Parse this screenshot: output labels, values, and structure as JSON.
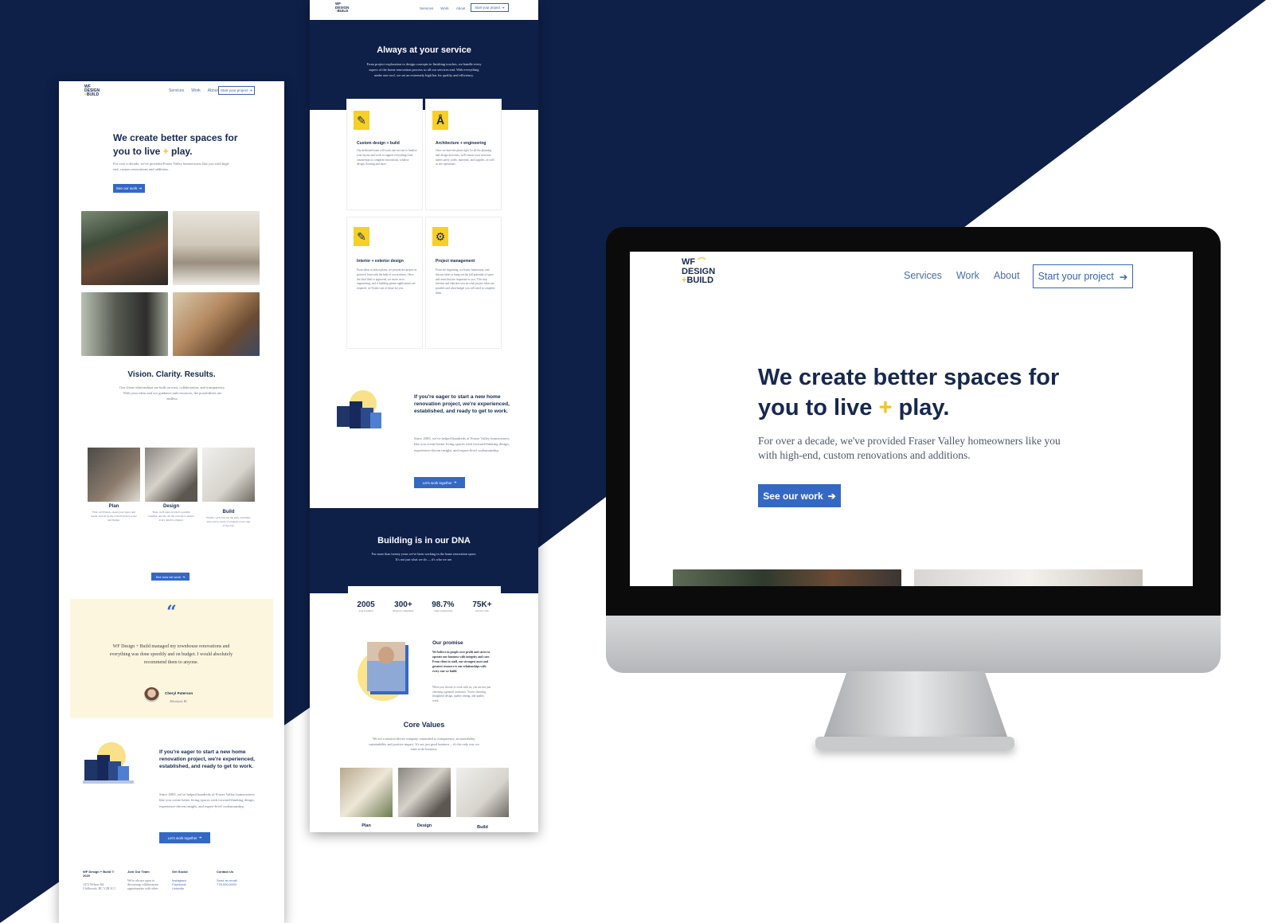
{
  "brand": {
    "logo_line1": "WF",
    "logo_line2": "DESIGN",
    "logo_plus": "+",
    "logo_line3": "BUILD",
    "accent": "#f4c21a",
    "navy": "#0e1f48",
    "blue": "#3468c4"
  },
  "nav": {
    "services": "Services",
    "work": "Work",
    "about": "About",
    "cta": "Start your project",
    "cta_icon": "arrow-right-icon"
  },
  "hero": {
    "title_line1": "We create better spaces for",
    "title_pre": "you to live ",
    "title_plus": "+",
    "title_post": " play.",
    "body_line1": "For over a decade, we've provided Fraser Valley homeowners like you",
    "body_line2": "with high-end, custom renovations and additions.",
    "cta": "See our work"
  },
  "home_page": {
    "vision_title": "Vision. Clarity. Results.",
    "vision_body": "Our client relationships are built on trust, collaboration, and transparency. With your ideas and our guidance and resources, the possibilities are endless.",
    "steps": [
      {
        "label": "Plan",
        "body": "First, we'll listen, assess your space and needs, and set up the overall project scope and budget."
      },
      {
        "label": "Design",
        "body": "Then, we'll explore what's possible together, and lay out the concept to ensure every detail is aligned."
      },
      {
        "label": "Build",
        "body": "Finally, we'll execute the plan, and make sure you're aware of progress every step of the way."
      }
    ],
    "steps_cta": "See how we work",
    "quote_icon": "quote-icon",
    "quote": "WF Design + Build managed my townhouse renovations and everything was done speedily and on budget. I would absolutely recommend them to anyone.",
    "author": "Cheryl Paterson",
    "author_location": "Abbotsford, BC",
    "eager_title": "If you're eager to start a new home renovation project, we're experienced, established, and ready to get to work.",
    "eager_body": "Since 2005, we've helped hundreds of Fraser Valley homeowners like you create better living spaces with forward-thinking design, experience-driven insight, and expert-level craftsmanship.",
    "eager_cta": "Let's work together",
    "footer": {
      "col1_title": "WF Design + Build © 2020",
      "col1_lines": [
        "1472 Wilson Rd.",
        "Chilliwack, BC V2R 5C1"
      ],
      "col2_title": "Join Our Team",
      "col2_lines": [
        "We're always open to",
        "discussing collaboration",
        "opportunities with other"
      ],
      "col3_title": "Get Social",
      "col3_lines": [
        "Instagram",
        "Facebook",
        "LinkedIn"
      ],
      "col4_title": "Contact Us",
      "col4_lines": [
        "Send an email",
        "778-000-0000"
      ]
    }
  },
  "services_page": {
    "title": "Always at your service",
    "intro": "From project exploration to design concepts to finishing touches, we handle every aspect of the home renovation process so all our services end. With everything under one roof, we set an extremely high bar for quality and efficiency.",
    "services": [
      {
        "title": "Custom design + build",
        "icon": "pencil-ruler-icon",
        "body": "Our dedicated team will work one-on-one to finalize your layout and work to support everything from countertops to complete renovations, window design, flooring and more."
      },
      {
        "title": "Architecture + engineering",
        "icon": "compass-icon",
        "body": "Once we have the plans right for all the planning and design decisions, we'll ensure your structure meets safety codes, materials, and supplies, as well as site operations."
      },
      {
        "title": "Interior + exterior design",
        "icon": "pencil-ruler-icon",
        "body": "From ideas to drawn plans, we present the project in pictured form with the help of our architect. Once the final draft is approved, we move on to engineering, and if building permit applications are required, we'll take care of those for you."
      },
      {
        "title": "Project management",
        "icon": "gears-icon",
        "body": "From the beginning, we listen, brainstorm, and discuss ideas to hang out the full potential of space and areas that are important to you. This step informs and educates you on what project ideas are possible and what budget you will need to complete them."
      }
    ],
    "eager_title": "If you're eager to start a new home renovation project, we're experienced, established, and ready to get to work.",
    "eager_body": "Since 2005, we've helped hundreds of Fraser Valley homeowners like you create better living spaces with forward-thinking design, experience-driven insight, and expert-level craftsmanship.",
    "eager_cta": "Let's work together"
  },
  "about_page": {
    "dna_title": "Building is in our DNA",
    "dna_body": "For more than twenty years we've been working in the home renovation space. It's not just what we do — it's who we are.",
    "stats": [
      {
        "value": "2005",
        "label": "year founded"
      },
      {
        "value": "300+",
        "label": "Projects completed"
      },
      {
        "value": "98.7%",
        "label": "client satisfaction"
      },
      {
        "value": "75K+",
        "label": "service calls"
      }
    ],
    "promise_title": "Our promise",
    "promise_body": "We believe in people over profit and strive to operate our business with integrity and care. From client to staff, our strongest asset and greatest resource is our relationships with every one we build.",
    "promise_body2": "When you choose to work with us, you are not just choosing a general contractor. You're choosing thoughtful design, quality timing, and quality work.",
    "values_title": "Core Values",
    "values_body": "We are a mission-driven company committed to transparency, accountability, sustainability and positive impact. It's not just good business – it's the only way we want to do business.",
    "values": [
      "Plan",
      "Design",
      "Build"
    ]
  }
}
